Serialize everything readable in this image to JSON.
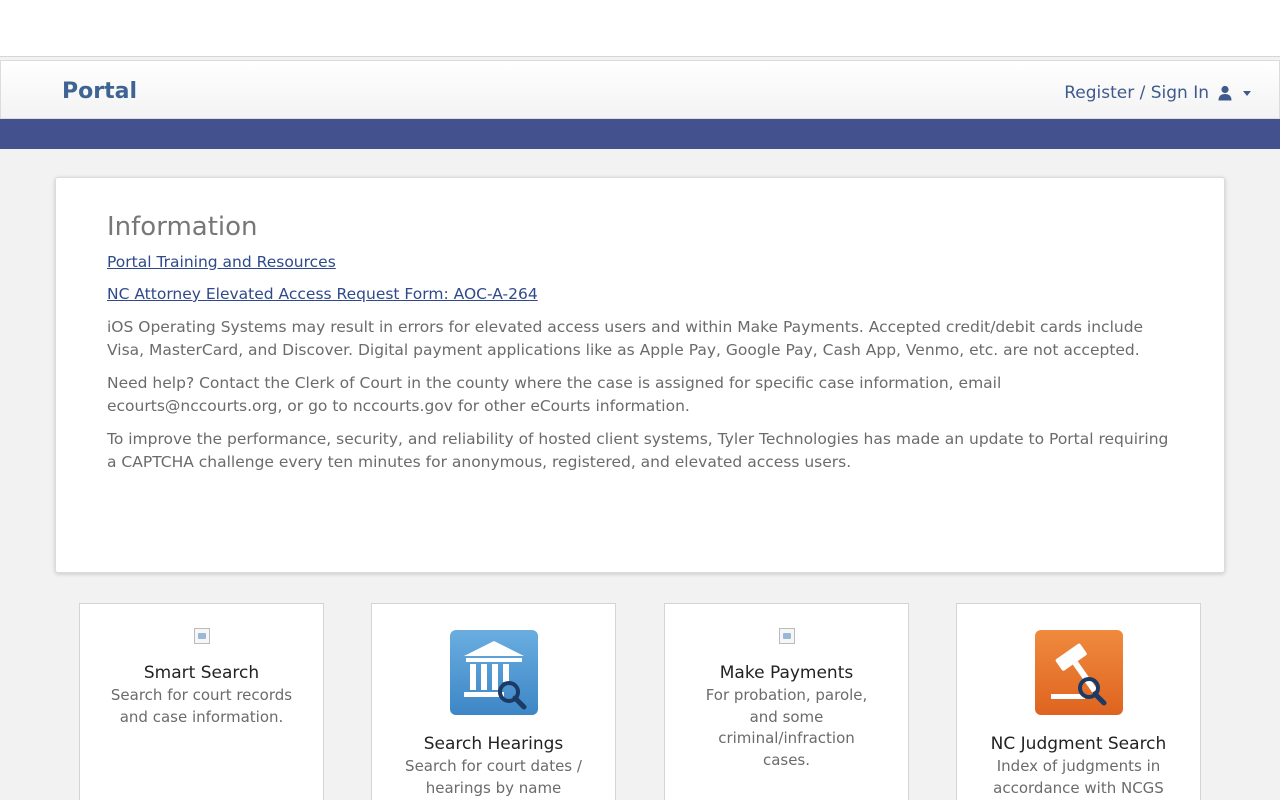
{
  "header": {
    "brand": "Portal",
    "signin_label": "Register / Sign In"
  },
  "icons": {
    "user": "user-icon",
    "caret": "caret-down-icon",
    "courthouse": "courthouse-search-icon",
    "gavel": "gavel-search-icon"
  },
  "colors": {
    "brand": "#3f6494",
    "band": "#43528e",
    "link": "#2f4a8a",
    "hearings_icon": "#5b9bd5",
    "judgment_icon": "#e8702a"
  },
  "info": {
    "title": "Information",
    "link1": "Portal Training and Resources",
    "link2": "NC Attorney Elevated Access Request Form: AOC-A-264",
    "para1": "iOS Operating Systems may result in errors for elevated access users and within Make Payments. Accepted credit/debit cards include Visa, MasterCard, and Discover. Digital payment applications like as Apple Pay, Google Pay, Cash App, Venmo, etc. are not accepted.",
    "para2": "Need help? Contact the Clerk of Court in the county where the case is assigned for specific case information, email ecourts@nccourts.org, or go to nccourts.gov for other eCourts information.",
    "para3": "To improve the performance, security, and reliability of hosted client systems, Tyler Technologies has made an update to Portal requiring a CAPTCHA challenge every ten minutes for anonymous, registered, and elevated access users."
  },
  "tiles": [
    {
      "title": "Smart Search",
      "desc": "Search for court records and case information."
    },
    {
      "title": "Search Hearings",
      "desc": "Search for court dates / hearings by name"
    },
    {
      "title": "Make Payments",
      "desc": "For probation, parole, and some criminal/infraction cases."
    },
    {
      "title": "NC Judgment Search",
      "desc": "Index of judgments in accordance with NCGS"
    }
  ]
}
